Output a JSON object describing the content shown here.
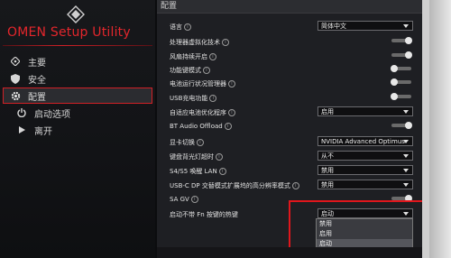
{
  "app": {
    "brand": "OMEN Setup Utility"
  },
  "nav": [
    {
      "label": "主要",
      "icon": "diamond-icon"
    },
    {
      "label": "安全",
      "icon": "shield-icon"
    },
    {
      "label": "配置",
      "icon": "gear-icon",
      "active": true
    },
    {
      "label": "启动选项",
      "icon": "power-icon"
    },
    {
      "label": "离开",
      "icon": "exit-arrow-icon"
    }
  ],
  "panel": {
    "title": "配置",
    "rows": [
      {
        "label": "语言",
        "info": true,
        "control": "select",
        "value": "简体中文"
      },
      {
        "label": "处理器虚拟化技术",
        "info": true,
        "control": "toggle",
        "on": true
      },
      {
        "label": "风扇持续开启",
        "info": true,
        "control": "toggle",
        "on": true
      },
      {
        "label": "功能键模式",
        "info": true,
        "control": "toggle",
        "on": false
      },
      {
        "label": "电池运行状况管理器",
        "info": true,
        "control": "toggle",
        "on": false
      },
      {
        "label": "USB充电功能",
        "info": true,
        "control": "toggle",
        "on": false
      },
      {
        "label": "自适应电池优化程序",
        "info": true,
        "control": "select",
        "value": "启用"
      },
      {
        "label": "BT Audio Offload",
        "info": true,
        "control": "toggle",
        "on": true
      },
      {
        "label": "显卡切换",
        "info": true,
        "control": "select",
        "value": "NVIDIA Advanced Optimus"
      },
      {
        "label": "键盘背光灯超时",
        "info": true,
        "control": "select",
        "value": "从不"
      },
      {
        "label": "S4/S5 唤醒 LAN",
        "info": true,
        "control": "select",
        "value": "禁用"
      },
      {
        "label": "USB-C DP 交替模式扩展坞的高分辨率模式",
        "info": true,
        "control": "select",
        "value": "禁用"
      },
      {
        "label": "SA GV",
        "info": true,
        "control": "toggle",
        "on": true
      },
      {
        "label": "启动不带 Fn 按键的热键",
        "info": false,
        "control": "select",
        "value": "启动"
      }
    ],
    "dropdown_options": [
      "禁用",
      "启用",
      "启动"
    ],
    "dropdown_selected": "启动"
  },
  "colors": {
    "accent": "#d12026",
    "highlight_box": "#e0161c"
  }
}
